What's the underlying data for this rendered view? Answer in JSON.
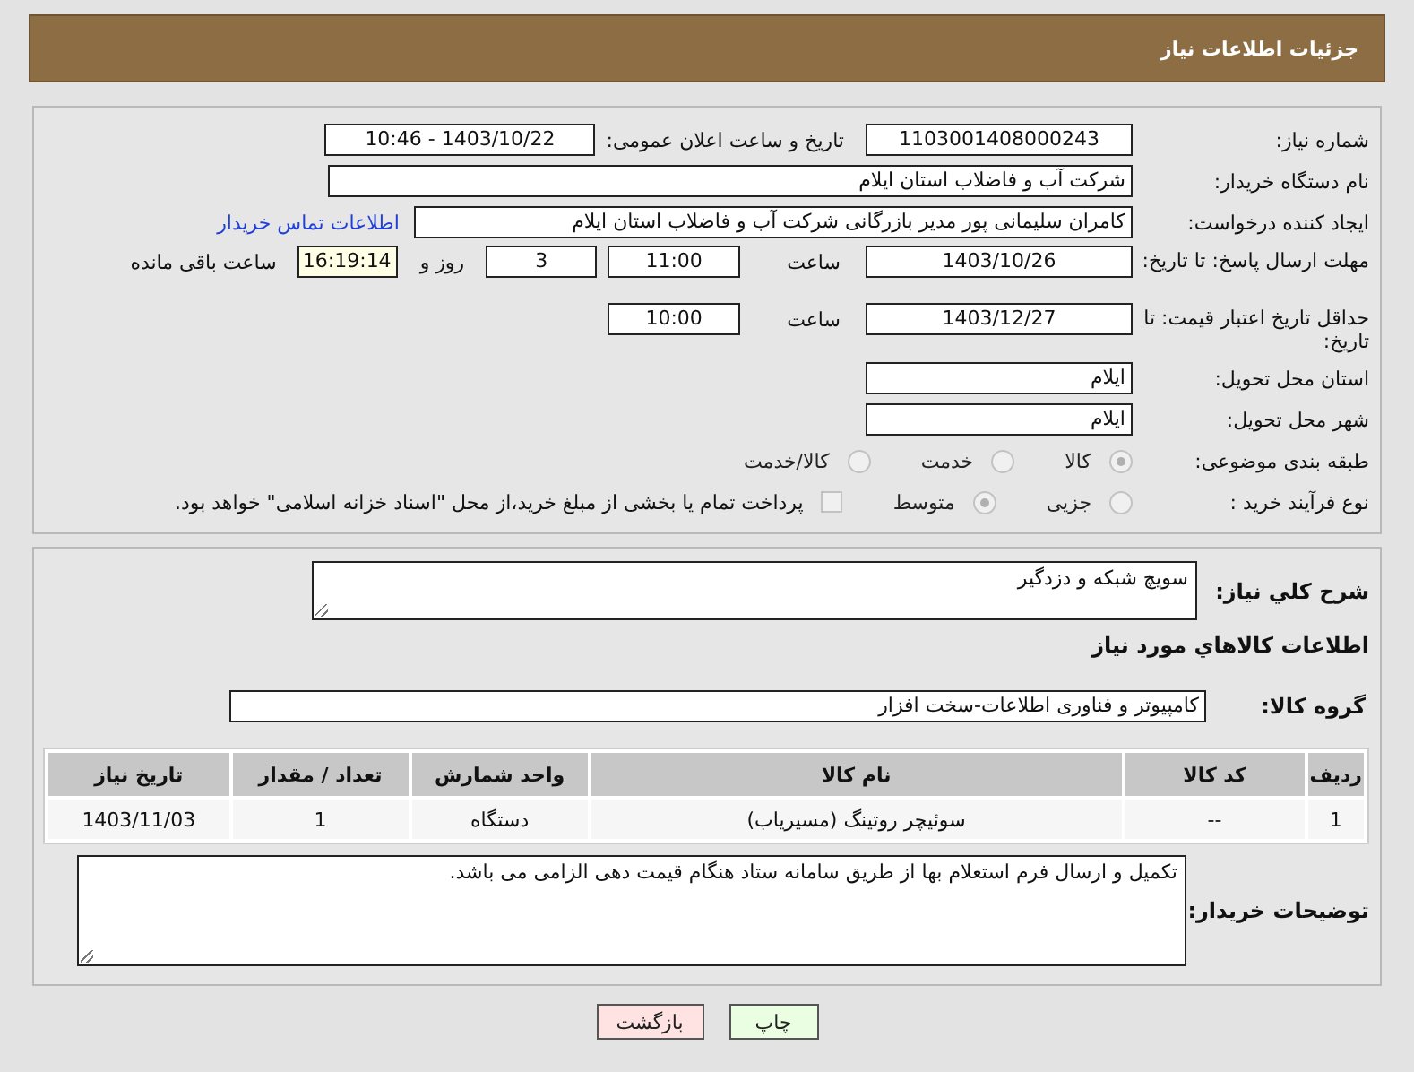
{
  "header": {
    "title": "جزئیات اطلاعات نیاز"
  },
  "form": {
    "rows": [
      {
        "label": "شماره نیاز:",
        "items": [
          {
            "kind": "field",
            "value": "1103001408000243"
          },
          {
            "kind": "text",
            "text": "تاریخ و ساعت اعلان عمومی:"
          },
          {
            "kind": "field",
            "value": "1403/10/22 - 10:46"
          }
        ]
      },
      {
        "label": "نام دستگاه خریدار:",
        "items": [
          {
            "kind": "field",
            "value": "شرکت آب و فاضلاب استان ایلام"
          }
        ]
      },
      {
        "label": "ایجاد کننده درخواست:",
        "items": [
          {
            "kind": "field",
            "value": "کامران سلیمانی پور مدیر بازرگانی شرکت آب و فاضلاب استان ایلام"
          },
          {
            "kind": "link",
            "text": "اطلاعات تماس خریدار"
          }
        ]
      },
      {
        "label": "مهلت ارسال پاسخ: تا تاریخ:",
        "items": [
          {
            "kind": "field",
            "value": "1403/10/26"
          },
          {
            "kind": "text",
            "text": "ساعت"
          },
          {
            "kind": "field",
            "value": "11:00"
          },
          {
            "kind": "field",
            "value": "3"
          },
          {
            "kind": "text",
            "text": "روز و"
          },
          {
            "kind": "countdown",
            "value": "16:19:14"
          },
          {
            "kind": "text",
            "text": "ساعت باقی مانده"
          }
        ]
      },
      {
        "label": "حداقل تاریخ اعتبار قیمت: تا تاریخ:",
        "items": [
          {
            "kind": "field",
            "value": "1403/12/27"
          },
          {
            "kind": "text",
            "text": "ساعت"
          },
          {
            "kind": "field",
            "value": "10:00"
          }
        ]
      },
      {
        "label": "استان محل تحویل:",
        "items": [
          {
            "kind": "field",
            "value": "ایلام"
          }
        ]
      },
      {
        "label": "شهر محل تحویل:",
        "items": [
          {
            "kind": "field",
            "value": "ایلام"
          }
        ]
      },
      {
        "label": "طبقه بندی موضوعی:",
        "items": [
          {
            "kind": "radio",
            "text": "کالا",
            "selected": true,
            "disabled": true
          },
          {
            "kind": "radio",
            "text": "خدمت",
            "selected": false,
            "disabled": true
          },
          {
            "kind": "radio",
            "text": "کالا/خدمت",
            "selected": false,
            "disabled": true
          }
        ]
      },
      {
        "label": "نوع فرآیند خرید :",
        "items": [
          {
            "kind": "radio",
            "text": "جزیی",
            "selected": false,
            "disabled": true
          },
          {
            "kind": "radio",
            "text": "متوسط",
            "selected": true,
            "disabled": true
          },
          {
            "kind": "checkbox",
            "text": "پرداخت تمام یا بخشی از مبلغ خرید،از محل \"اسناد خزانه اسلامی\" خواهد بود.",
            "checked": false,
            "disabled": true
          }
        ]
      }
    ]
  },
  "description": {
    "label": "شرح کلي نياز:",
    "value": "سویچ شبکه و دزدگیر"
  },
  "items_heading": "اطلاعات کالاهاي مورد نياز",
  "goods_group": {
    "label": "گروه کالا:",
    "value": "کامپیوتر و فناوری اطلاعات-سخت افزار"
  },
  "table": {
    "columns": [
      "ردیف",
      "کد کالا",
      "نام کالا",
      "واحد شمارش",
      "تعداد / مقدار",
      "تاریخ نیاز"
    ],
    "rows": [
      [
        "1",
        "--",
        "سوئیچر روتینگ (مسیریاب)",
        "دستگاه",
        "1",
        "1403/11/03"
      ]
    ]
  },
  "buyer_notes": {
    "label": "توضیحات خریدار:",
    "value": "تکمیل و ارسال فرم استعلام بها از طریق سامانه ستاد هنگام قیمت دهی الزامی می باشد."
  },
  "buttons": [
    {
      "kind": "print",
      "label": "چاپ"
    },
    {
      "kind": "back",
      "label": "بازگشت"
    }
  ]
}
